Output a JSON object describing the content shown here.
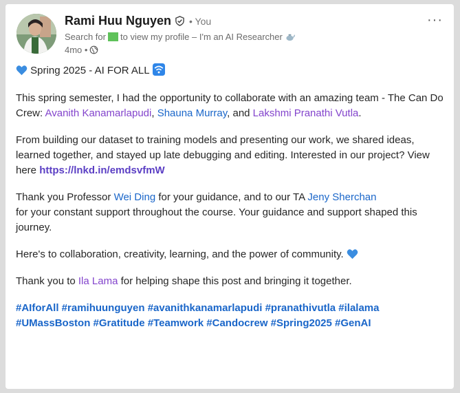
{
  "post": {
    "author_name": "Rami Huu Nguyen",
    "you_label": "• You",
    "headline_before": "Search for",
    "headline_after": "to view my profile – I'm an AI Researcher",
    "time_ago": "4mo •",
    "menu_label": "···",
    "title": "Spring 2025 - AI FOR ALL",
    "p1_text": "This spring semester, I had the opportunity to collaborate with an amazing team - The Can Do Crew: ",
    "mention_avanith": "Avanith Kanamarlapudi",
    "sep1": ", ",
    "mention_shauna": "Shauna Murray",
    "sep2": ", and ",
    "mention_lakshmi": "Lakshmi Pranathi Vutla",
    "p1_end": ".",
    "p2_text": "From building our dataset to training models and presenting our work, we shared ideas, learned together, and stayed up late debugging and editing. Interested in our project? View here ",
    "project_link": "https://lnkd.in/emdsvfmW",
    "p3_a": "Thank you Professor ",
    "mention_wei": "Wei Ding",
    "p3_b": " for your guidance, and to our TA ",
    "mention_jeny": "Jeny Sherchan",
    "p3_c": " for your constant support throughout the course. Your guidance and support shaped this journey.",
    "p4_text": "Here's to collaboration, creativity, learning, and the power of community.",
    "p5_a": "Thank you to ",
    "mention_ila": "Ila Lama",
    "p5_b": " for helping shape this post and bringing it together.",
    "hashtags_line1": "#AIforAll #ramihuunguyen #avanithkanamarlapudi #pranathivutla #ilalama",
    "hashtags_line2": "#UMassBoston #Gratitude #Teamwork #Candocrew #Spring2025 #GenAI",
    "icons": [
      "verified-icon",
      "globe-icon",
      "blue-heart-icon",
      "wifi-icon",
      "teapot-icon",
      "more-options-icon"
    ],
    "colors": {
      "mention_purple": "#8344cc",
      "mention_blue": "#1a66c9",
      "link": "#5b3fc4",
      "heart": "#3b8de0"
    }
  }
}
